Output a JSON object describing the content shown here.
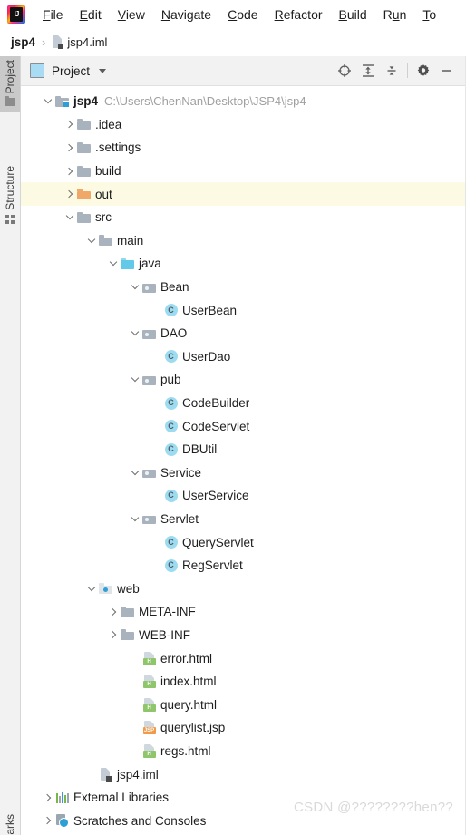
{
  "window": {
    "app": "IntelliJ IDEA",
    "logo_label": "IJ"
  },
  "menubar": {
    "items": [
      {
        "label": "File",
        "mnemonic": "F"
      },
      {
        "label": "Edit",
        "mnemonic": "E"
      },
      {
        "label": "View",
        "mnemonic": "V"
      },
      {
        "label": "Navigate",
        "mnemonic": "N"
      },
      {
        "label": "Code",
        "mnemonic": "C"
      },
      {
        "label": "Refactor",
        "mnemonic": "R"
      },
      {
        "label": "Build",
        "mnemonic": "B"
      },
      {
        "label": "Run",
        "mnemonic": "u"
      },
      {
        "label": "To",
        "mnemonic": "T"
      }
    ]
  },
  "breadcrumb": {
    "project": "jsp4",
    "separator": "›",
    "file": "jsp4.iml"
  },
  "left_strip": {
    "tabs": [
      {
        "label": "Project",
        "icon": "folder-icon",
        "active": true
      },
      {
        "label": "Structure",
        "icon": "structure-icon",
        "active": false
      }
    ],
    "bottom_tab": {
      "label": "arks",
      "full": "Bookmarks"
    }
  },
  "panel_header": {
    "title": "Project",
    "dropdown_caret": "▾",
    "buttons": [
      {
        "name": "select-opened-file-button",
        "icon": "target-icon"
      },
      {
        "name": "expand-all-button",
        "icon": "expand-all-icon"
      },
      {
        "name": "collapse-all-button",
        "icon": "collapse-all-icon"
      },
      {
        "name": "settings-button",
        "icon": "gear-icon"
      },
      {
        "name": "hide-button",
        "icon": "minimize-icon"
      }
    ]
  },
  "tree": {
    "nodes": [
      {
        "id": "jsp4",
        "label": "jsp4",
        "path": "C:\\Users\\ChenNan\\Desktop\\JSP4\\jsp4",
        "indent": 0,
        "arrow": "down",
        "icon": "module-folder-icon",
        "bold": true,
        "highlight": false
      },
      {
        "id": "idea",
        "label": ".idea",
        "indent": 1,
        "arrow": "right",
        "icon": "folder-icon",
        "bold": false,
        "highlight": false
      },
      {
        "id": "settings",
        "label": ".settings",
        "indent": 1,
        "arrow": "right",
        "icon": "folder-icon",
        "bold": false,
        "highlight": false
      },
      {
        "id": "build",
        "label": "build",
        "indent": 1,
        "arrow": "right",
        "icon": "folder-icon",
        "bold": false,
        "highlight": false
      },
      {
        "id": "out",
        "label": "out",
        "indent": 1,
        "arrow": "right",
        "icon": "excluded-folder-icon",
        "bold": false,
        "highlight": true
      },
      {
        "id": "src",
        "label": "src",
        "indent": 1,
        "arrow": "down",
        "icon": "folder-icon",
        "bold": false,
        "highlight": false
      },
      {
        "id": "main",
        "label": "main",
        "indent": 2,
        "arrow": "down",
        "icon": "folder-icon",
        "bold": false,
        "highlight": false
      },
      {
        "id": "java",
        "label": "java",
        "indent": 3,
        "arrow": "down",
        "icon": "source-folder-icon",
        "bold": false,
        "highlight": false
      },
      {
        "id": "Bean",
        "label": "Bean",
        "indent": 4,
        "arrow": "down",
        "icon": "package-folder-icon",
        "bold": false,
        "highlight": false
      },
      {
        "id": "UserBean",
        "label": "UserBean",
        "indent": 5,
        "arrow": "none",
        "icon": "java-class-icon",
        "bold": false,
        "highlight": false
      },
      {
        "id": "DAO",
        "label": "DAO",
        "indent": 4,
        "arrow": "down",
        "icon": "package-folder-icon",
        "bold": false,
        "highlight": false
      },
      {
        "id": "UserDao",
        "label": "UserDao",
        "indent": 5,
        "arrow": "none",
        "icon": "java-class-icon",
        "bold": false,
        "highlight": false
      },
      {
        "id": "pub",
        "label": "pub",
        "indent": 4,
        "arrow": "down",
        "icon": "package-folder-icon",
        "bold": false,
        "highlight": false
      },
      {
        "id": "CodeBuilder",
        "label": "CodeBuilder",
        "indent": 5,
        "arrow": "none",
        "icon": "java-class-icon",
        "bold": false,
        "highlight": false
      },
      {
        "id": "CodeServlet",
        "label": "CodeServlet",
        "indent": 5,
        "arrow": "none",
        "icon": "java-class-icon",
        "bold": false,
        "highlight": false
      },
      {
        "id": "DBUtil",
        "label": "DBUtil",
        "indent": 5,
        "arrow": "none",
        "icon": "java-class-icon",
        "bold": false,
        "highlight": false
      },
      {
        "id": "Service",
        "label": "Service",
        "indent": 4,
        "arrow": "down",
        "icon": "package-folder-icon",
        "bold": false,
        "highlight": false
      },
      {
        "id": "UserService",
        "label": "UserService",
        "indent": 5,
        "arrow": "none",
        "icon": "java-class-icon",
        "bold": false,
        "highlight": false
      },
      {
        "id": "Servlet",
        "label": "Servlet",
        "indent": 4,
        "arrow": "down",
        "icon": "package-folder-icon",
        "bold": false,
        "highlight": false
      },
      {
        "id": "QueryServlet",
        "label": "QueryServlet",
        "indent": 5,
        "arrow": "none",
        "icon": "java-class-icon",
        "bold": false,
        "highlight": false
      },
      {
        "id": "RegServlet",
        "label": "RegServlet",
        "indent": 5,
        "arrow": "none",
        "icon": "java-class-icon",
        "bold": false,
        "highlight": false
      },
      {
        "id": "web",
        "label": "web",
        "indent": 2,
        "arrow": "down",
        "icon": "web-folder-icon",
        "bold": false,
        "highlight": false
      },
      {
        "id": "META-INF",
        "label": "META-INF",
        "indent": 3,
        "arrow": "right",
        "icon": "folder-icon",
        "bold": false,
        "highlight": false
      },
      {
        "id": "WEB-INF",
        "label": "WEB-INF",
        "indent": 3,
        "arrow": "right",
        "icon": "folder-icon",
        "bold": false,
        "highlight": false
      },
      {
        "id": "error.html",
        "label": "error.html",
        "indent": 4,
        "arrow": "none",
        "icon": "html-file-icon",
        "badge": "H",
        "bold": false,
        "highlight": false
      },
      {
        "id": "index.html",
        "label": "index.html",
        "indent": 4,
        "arrow": "none",
        "icon": "html-file-icon",
        "badge": "H",
        "bold": false,
        "highlight": false
      },
      {
        "id": "query.html",
        "label": "query.html",
        "indent": 4,
        "arrow": "none",
        "icon": "html-file-icon",
        "badge": "H",
        "bold": false,
        "highlight": false
      },
      {
        "id": "querylist.jsp",
        "label": "querylist.jsp",
        "indent": 4,
        "arrow": "none",
        "icon": "jsp-file-icon",
        "badge": "JSP",
        "bold": false,
        "highlight": false
      },
      {
        "id": "regs.html",
        "label": "regs.html",
        "indent": 4,
        "arrow": "none",
        "icon": "html-file-icon",
        "badge": "H",
        "bold": false,
        "highlight": false
      },
      {
        "id": "jsp4.iml",
        "label": "jsp4.iml",
        "indent": 2,
        "arrow": "none",
        "icon": "iml-file-icon",
        "bold": false,
        "highlight": false
      },
      {
        "id": "ExternalLibraries",
        "label": "External Libraries",
        "indent": 0,
        "arrow": "right",
        "icon": "external-libraries-icon",
        "bold": false,
        "highlight": false
      },
      {
        "id": "Scratches",
        "label": "Scratches and Consoles",
        "indent": 0,
        "arrow": "right",
        "icon": "scratches-icon",
        "bold": false,
        "highlight": false
      }
    ]
  },
  "watermark": {
    "text": "CSDN @????????hen??"
  },
  "colors": {
    "excluded_folder": "#f0a868",
    "source_folder": "#62c9e8",
    "class_icon": "#9ddcf0",
    "html_badge": "#8fc66b",
    "jsp_badge": "#f09b4a",
    "row_highlight": "#fcfae3",
    "path_text": "#a0a0a0"
  }
}
